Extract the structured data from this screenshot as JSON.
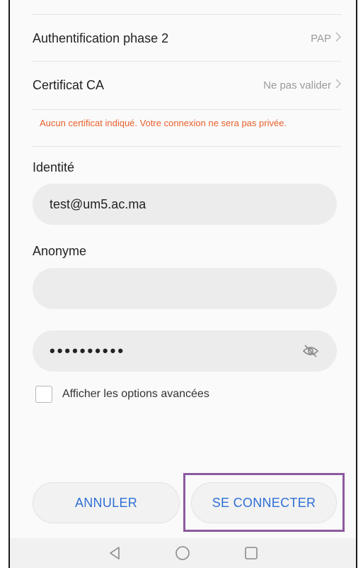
{
  "settings": {
    "auth_phase2": {
      "label": "Authentification phase 2",
      "value": "PAP"
    },
    "ca_certificate": {
      "label": "Certificat CA",
      "value": "Ne pas valider"
    },
    "warning": "Aucun certificat indiqué. Votre connexion ne sera pas privée."
  },
  "identity": {
    "label": "Identité",
    "value": "test@um5.ac.ma"
  },
  "anonymous": {
    "label": "Anonyme",
    "value": ""
  },
  "password": {
    "masked": "••••••••••"
  },
  "advanced_options": {
    "label": "Afficher les options avancées",
    "checked": false
  },
  "buttons": {
    "cancel": "ANNULER",
    "connect": "SE CONNECTER"
  },
  "colors": {
    "accent": "#2e6fd6",
    "warning": "#e8602c",
    "highlight": "#8c5aa0"
  },
  "icons": [
    "chevron-right-icon",
    "eye-off-icon",
    "back-icon",
    "home-icon",
    "recents-icon"
  ]
}
